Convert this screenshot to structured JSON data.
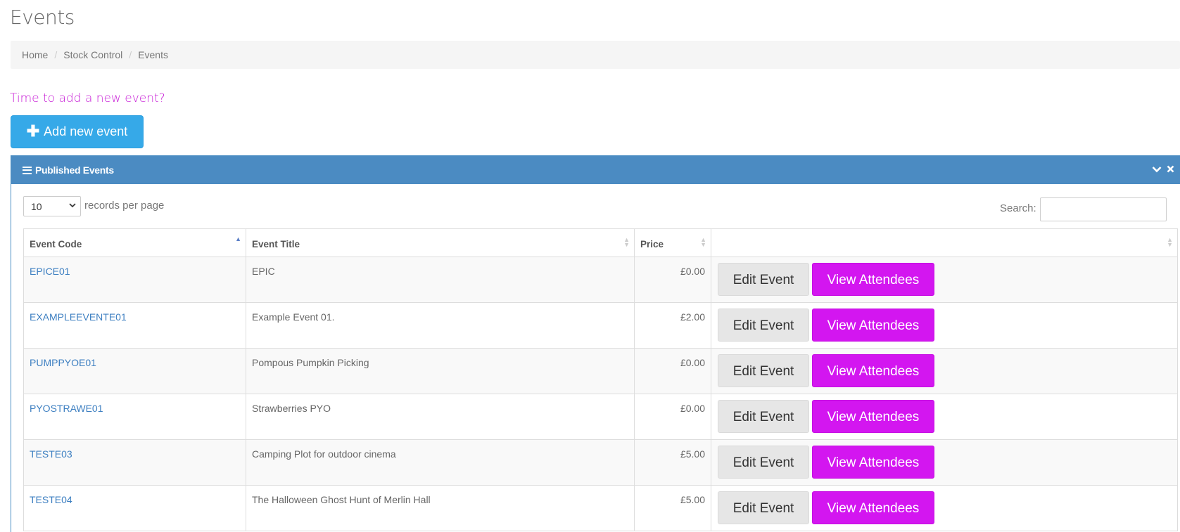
{
  "page": {
    "title": "Events"
  },
  "breadcrumb": {
    "items": [
      "Home",
      "Stock Control",
      "Events"
    ]
  },
  "prompt": "Time to add a new event?",
  "add_button": {
    "label": "Add new event",
    "icon": "plus-icon"
  },
  "panel": {
    "title": "Published Events",
    "icons": [
      "bars-icon",
      "chevron-down-icon",
      "close-icon"
    ]
  },
  "length": {
    "value": "10",
    "label": "records per page"
  },
  "search": {
    "label": "Search:",
    "value": ""
  },
  "table": {
    "headers": [
      "Event Code",
      "Event Title",
      "Price",
      ""
    ],
    "rows": [
      {
        "code": "EPICE01",
        "title": "EPIC",
        "price": "£0.00"
      },
      {
        "code": "EXAMPLEEVENTE01",
        "title": "Example Event 01.",
        "price": "£2.00"
      },
      {
        "code": "PUMPPYOE01",
        "title": "Pompous Pumpkin Picking",
        "price": "£0.00"
      },
      {
        "code": "PYOSTRAWE01",
        "title": "Strawberries PYO",
        "price": "£0.00"
      },
      {
        "code": "TESTE03",
        "title": "Camping Plot for outdoor cinema",
        "price": "£5.00"
      },
      {
        "code": "TESTE04",
        "title": "The Halloween Ghost Hunt of Merlin Hall",
        "price": "£5.00"
      }
    ],
    "edit_label": "Edit Event",
    "view_label": "View Attendees"
  },
  "colors": {
    "accent": "#36a9e8",
    "magenta": "#d316f0",
    "panel": "#4b8bc2",
    "link": "#3d7fc1"
  }
}
